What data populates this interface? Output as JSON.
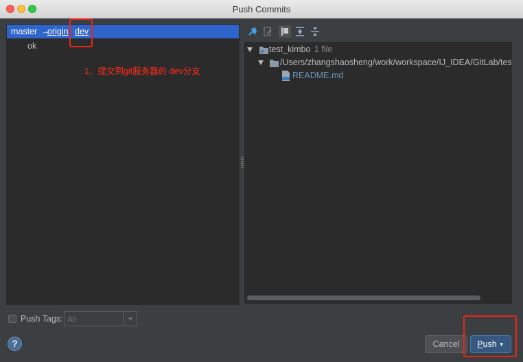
{
  "window": {
    "title": "Push Commits"
  },
  "commits": {
    "branch": {
      "local": "master",
      "arrow": "→",
      "remote": "origin",
      "separator": ":",
      "target": "dev"
    },
    "items": [
      {
        "message": "ok"
      }
    ]
  },
  "annotation": {
    "text": "1、提交到git服务器的 dev分支"
  },
  "changes": {
    "toolbar_icons": [
      "show-diff-icon",
      "edit-source-icon",
      "group-by-directory-icon",
      "expand-all-icon",
      "collapse-all-icon"
    ],
    "tree": {
      "repo": {
        "name": "test_kimbo",
        "count": "1 file"
      },
      "directory": {
        "path": "/Users/zhangshaosheng/work/workspace/IJ_IDEA/GitLab/test_kim"
      },
      "file": {
        "name": "README.md"
      }
    }
  },
  "push_tags": {
    "label": "Push Tags:",
    "checked": false,
    "selected": "All"
  },
  "buttons": {
    "help": "?",
    "cancel": "Cancel",
    "push": {
      "mnemonic": "P",
      "rest": "ush"
    }
  },
  "colors": {
    "background": "#3c3f41",
    "panel": "#2b2b2b",
    "selection": "#2f65ca",
    "file_text": "#6897bb",
    "annotation": "#ff2a1a",
    "primary_button": "#365880"
  }
}
